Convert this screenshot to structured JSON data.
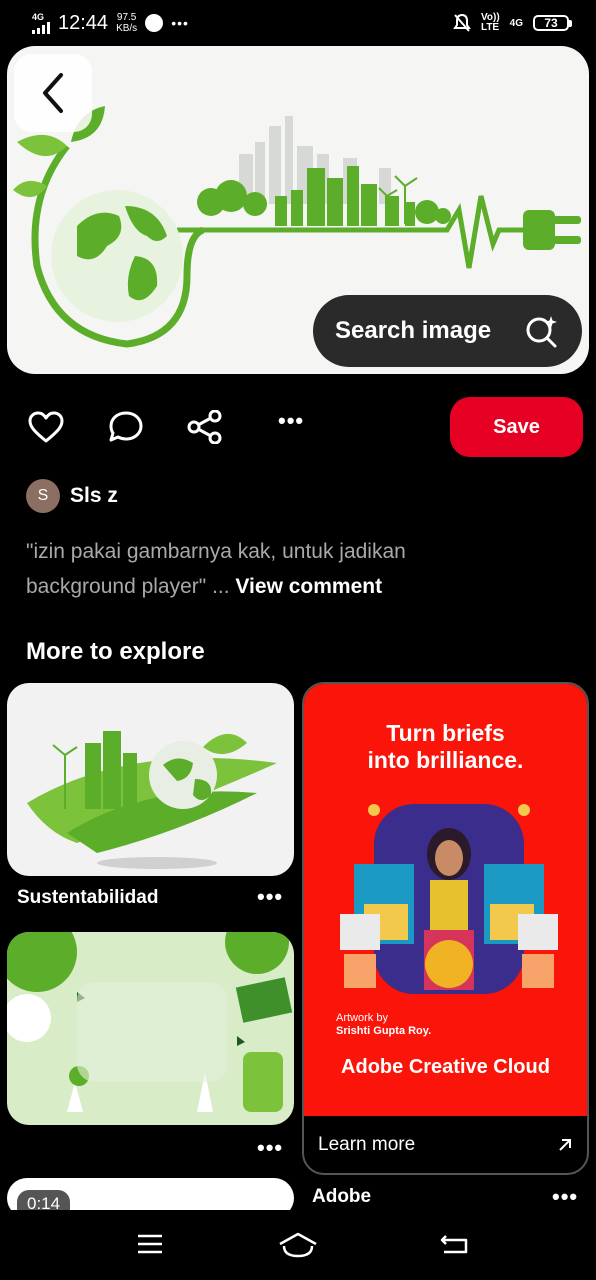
{
  "status_bar": {
    "network": "4G",
    "time": "12:44",
    "speed_value": "97.5",
    "speed_unit": "KB/s",
    "more": "•••",
    "volte": "Vo))",
    "lte": "LTE",
    "net2": "4G",
    "battery": "73"
  },
  "hero": {
    "search_label": "Search image"
  },
  "actions": {
    "save_label": "Save",
    "more": "•••"
  },
  "comment": {
    "avatar_letter": "S",
    "username": "Sls z",
    "text": "\"izin pakai gambarnya kak, untuk jadikan background player\" ...",
    "view_comment": "View comment"
  },
  "explore": {
    "title": "More to explore",
    "pins": [
      {
        "label": "Sustentabilidad",
        "more": "•••"
      },
      {
        "label": "",
        "more": "•••"
      },
      {
        "duration": "0:14"
      }
    ]
  },
  "ad": {
    "headline_line1": "Turn briefs",
    "headline_line2": "into brilliance.",
    "credit_line1": "Artwork by",
    "credit_line2": "Srishti Gupta Roy.",
    "brand_first": "Adobe",
    "brand_second": "Creative Cloud",
    "cta": "Learn more",
    "advertiser": "Adobe",
    "more": "•••"
  },
  "colors": {
    "save_red": "#e60023",
    "ad_red": "#fa1409",
    "leaf_green": "#5cae2a"
  }
}
